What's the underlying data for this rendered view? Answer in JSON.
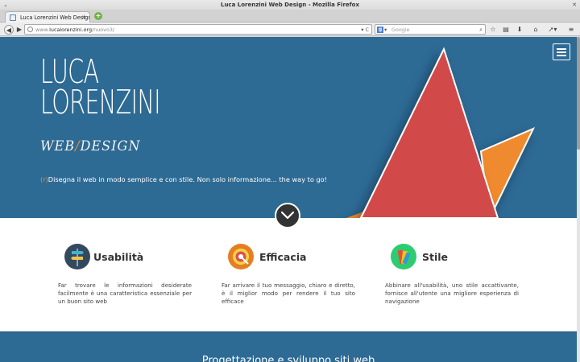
{
  "window": {
    "title": "Luca Lorenzini Web Design - Mozilla Firefox",
    "tab_title": "Luca Lorenzini Web Design",
    "tab_close": "✕"
  },
  "navbar": {
    "url_prefix": "www.",
    "url_domain": "lucalorenzini.org",
    "url_path": "/nuovo3/",
    "url_tail": "▾ C",
    "search_placeholder": "Google",
    "search_engine": "g"
  },
  "hero": {
    "logo_line1": "LUCA",
    "logo_line2": "LORENZINI",
    "subtitle_web": "WEB",
    "subtitle_slash": "/",
    "subtitle_design": "DESIGN",
    "tagline_prefix": "(r)",
    "tagline": "Disegna il web in modo semplice e con stile. Non solo informazione... the way to go!"
  },
  "features": [
    {
      "title": "Usabilità",
      "description": "Far trovare le informazioni desiderate facilmente è una caratteristica essenziale per un buon sito web",
      "icon": "signpost-icon",
      "color": "#34495e"
    },
    {
      "title": "Efficacia",
      "description": "Far arrivare il tuo messaggio, chiaro e diretto, è il miglior modo per rendere il tuo sito efficace",
      "icon": "target-icon",
      "color": "#e67e22"
    },
    {
      "title": "Stile",
      "description": "Abbinare all'usabilità, uno stile accattivante, fornisce all'utente una migliore esperienza di navigazione",
      "icon": "palette-icon",
      "color": "#2ecc71"
    }
  ],
  "band": {
    "title": "Progettazione e sviluppo siti web"
  },
  "colors": {
    "hero_bg": "#2d6a94",
    "accent_orange": "#f08a3c",
    "triangle_red": "#d24a48"
  }
}
